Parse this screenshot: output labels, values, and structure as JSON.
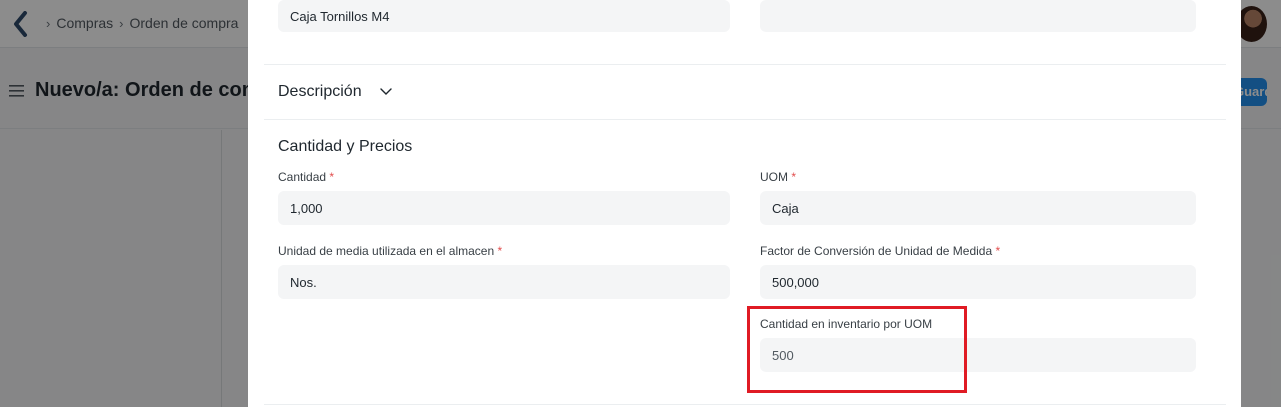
{
  "background": {
    "breadcrumb": [
      "Compras",
      "Orden de compra"
    ],
    "page_title": "Nuevo/a: Orden de compra",
    "save_label": "Guardar"
  },
  "modal": {
    "item_name_value": "Caja Tornillos M4",
    "item_right_value": "",
    "description_section": "Descripción",
    "qty_section": "Cantidad y Precios",
    "fields": {
      "qty": {
        "label": "Cantidad",
        "required": "*",
        "value": "1,000"
      },
      "uom": {
        "label": "UOM",
        "required": "*",
        "value": "Caja"
      },
      "stock_uom": {
        "label": "Unidad de media utilizada en el almacen",
        "required": "*",
        "value": "Nos."
      },
      "conversion_factor": {
        "label": "Factor de Conversión de Unidad de Medida",
        "required": "*",
        "value": "500,000"
      },
      "stock_qty": {
        "label": "Cantidad en inventario por UOM",
        "value": "500"
      }
    }
  },
  "colors": {
    "highlight": "#e01b24",
    "required": "#e24c4c",
    "primary": "#2490ef"
  }
}
